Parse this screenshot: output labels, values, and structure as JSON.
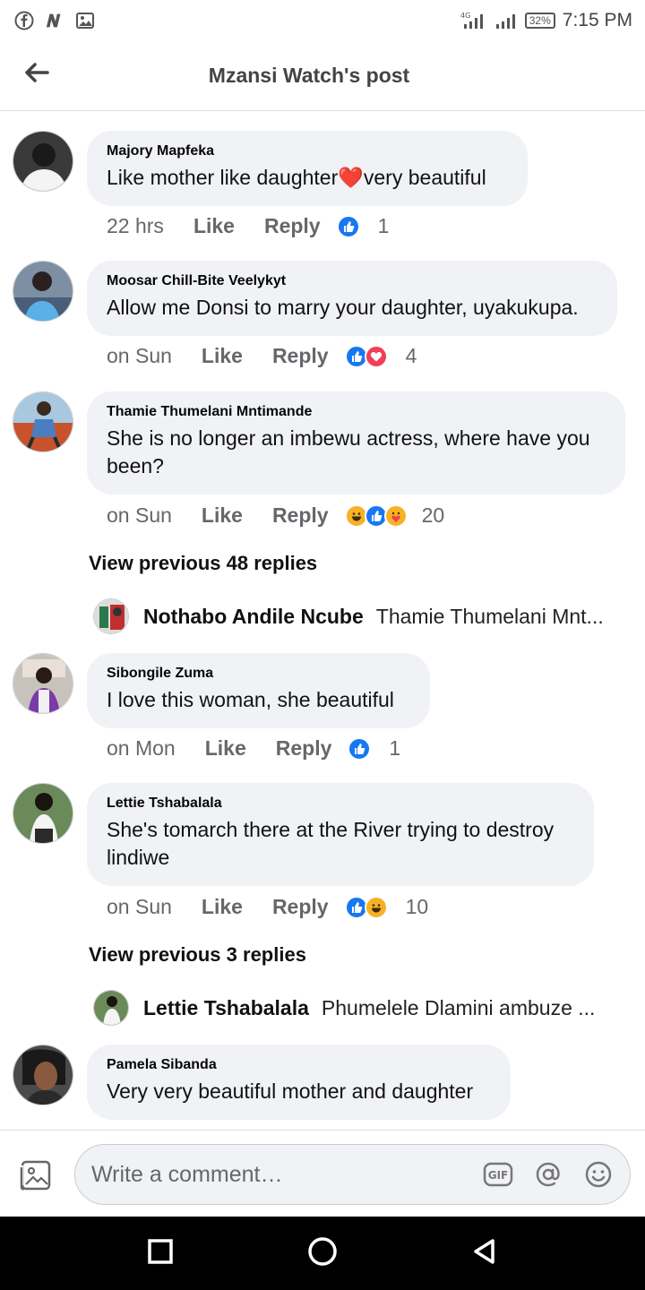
{
  "status_bar": {
    "network": "4G",
    "battery": "32%",
    "time": "7:15 PM"
  },
  "header": {
    "title": "Mzansi Watch's post"
  },
  "comments": [
    {
      "name": "Majory Mapfeka",
      "text": "Like mother like daughter❤️very beautiful",
      "time": "22 hrs",
      "like": "Like",
      "reply": "Reply",
      "reactions": [
        "like"
      ],
      "count": "1"
    },
    {
      "name": "Moosar Chill-Bite Veelykyt",
      "text": "Allow me Donsi to marry your daughter, uyakukupa.",
      "time": "on Sun",
      "like": "Like",
      "reply": "Reply",
      "reactions": [
        "like",
        "love"
      ],
      "count": "4"
    },
    {
      "name": "Thamie Thumelani Mntimande",
      "text": "She is no longer an imbewu actress, where have you been?",
      "time": "on Sun",
      "like": "Like",
      "reply": "Reply",
      "reactions": [
        "haha",
        "like",
        "care"
      ],
      "count": "20"
    },
    {
      "name": "Sibongile Zuma",
      "text": "I love this woman, she beautiful",
      "time": "on Mon",
      "like": "Like",
      "reply": "Reply",
      "reactions": [
        "like"
      ],
      "count": "1"
    },
    {
      "name": "Lettie Tshabalala",
      "text": "She's tomarch there at the River trying to destroy lindiwe",
      "time": "on Sun",
      "like": "Like",
      "reply": "Reply",
      "reactions": [
        "like",
        "haha"
      ],
      "count": "10"
    },
    {
      "name": "Pamela Sibanda",
      "text": "Very very beautiful mother and daughter"
    }
  ],
  "threads": [
    {
      "view_label": "View previous 48 replies",
      "reply_name": "Nothabo Andile Ncube",
      "reply_text": "Thamie Thumelani Mnt..."
    },
    {
      "view_label": "View previous 3 replies",
      "reply_name": "Lettie Tshabalala",
      "reply_text": "Phumelele Dlamini ambuze ..."
    }
  ],
  "composer": {
    "placeholder": "Write a comment…",
    "gif": "GIF"
  },
  "colors": {
    "like_blue": "#1877f2",
    "love_red": "#f33e58",
    "haha_yellow": "#f7b125",
    "bubble_bg": "#f0f2f5",
    "meta_gray": "#65676b"
  }
}
